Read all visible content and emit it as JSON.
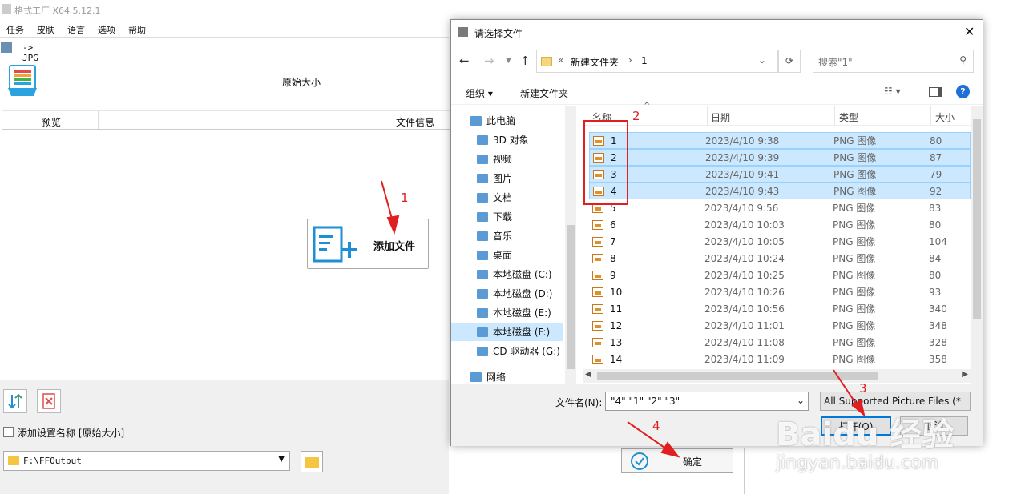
{
  "app": {
    "title": "格式工厂 X64 5.12.1",
    "menu": [
      "任务",
      "皮肤",
      "语言",
      "选项",
      "帮助"
    ],
    "path_label": "-> JPG",
    "size_label": "原始大小",
    "columns": {
      "preview": "预览",
      "fileinfo": "文件信息"
    },
    "add_file_label": "添加文件",
    "add_setting_label": "添加设置名称 [原始大小]",
    "output_folder": "F:\\FFOutput",
    "ok_label": "确定"
  },
  "dialog": {
    "title": "请选择文件",
    "breadcrumb": [
      "«",
      "新建文件夹",
      "›",
      "1"
    ],
    "search_placeholder": "搜索\"1\"",
    "organize_label": "组织 ▾",
    "new_folder_label": "新建文件夹",
    "nav": [
      {
        "label": "此电脑",
        "icon": "computer-icon"
      },
      {
        "label": "3D 对象",
        "icon": "cube-icon"
      },
      {
        "label": "视频",
        "icon": "video-icon"
      },
      {
        "label": "图片",
        "icon": "picture-icon"
      },
      {
        "label": "文档",
        "icon": "document-icon"
      },
      {
        "label": "下载",
        "icon": "download-icon"
      },
      {
        "label": "音乐",
        "icon": "music-icon"
      },
      {
        "label": "桌面",
        "icon": "desktop-icon"
      },
      {
        "label": "本地磁盘 (C:)",
        "icon": "drive-icon"
      },
      {
        "label": "本地磁盘 (D:)",
        "icon": "drive-icon"
      },
      {
        "label": "本地磁盘 (E:)",
        "icon": "drive-icon"
      },
      {
        "label": "本地磁盘 (F:)",
        "icon": "drive-icon"
      },
      {
        "label": "CD 驱动器 (G:)",
        "icon": "cd-icon"
      },
      {
        "label": "网络",
        "icon": "network-icon"
      }
    ],
    "headers": {
      "name": "名称",
      "date": "日期",
      "type": "类型",
      "size": "大小"
    },
    "files": [
      {
        "name": "1",
        "date": "2023/4/10 9:38",
        "type": "PNG 图像",
        "size": "80",
        "selected": true
      },
      {
        "name": "2",
        "date": "2023/4/10 9:39",
        "type": "PNG 图像",
        "size": "87",
        "selected": true
      },
      {
        "name": "3",
        "date": "2023/4/10 9:41",
        "type": "PNG 图像",
        "size": "79",
        "selected": true
      },
      {
        "name": "4",
        "date": "2023/4/10 9:43",
        "type": "PNG 图像",
        "size": "92",
        "selected": true
      },
      {
        "name": "5",
        "date": "2023/4/10 9:56",
        "type": "PNG 图像",
        "size": "83",
        "selected": false
      },
      {
        "name": "6",
        "date": "2023/4/10 10:03",
        "type": "PNG 图像",
        "size": "80",
        "selected": false
      },
      {
        "name": "7",
        "date": "2023/4/10 10:05",
        "type": "PNG 图像",
        "size": "104",
        "selected": false
      },
      {
        "name": "8",
        "date": "2023/4/10 10:24",
        "type": "PNG 图像",
        "size": "84",
        "selected": false
      },
      {
        "name": "9",
        "date": "2023/4/10 10:25",
        "type": "PNG 图像",
        "size": "80",
        "selected": false
      },
      {
        "name": "10",
        "date": "2023/4/10 10:26",
        "type": "PNG 图像",
        "size": "93",
        "selected": false
      },
      {
        "name": "11",
        "date": "2023/4/10 10:56",
        "type": "PNG 图像",
        "size": "340",
        "selected": false
      },
      {
        "name": "12",
        "date": "2023/4/10 11:01",
        "type": "PNG 图像",
        "size": "348",
        "selected": false
      },
      {
        "name": "13",
        "date": "2023/4/10 11:08",
        "type": "PNG 图像",
        "size": "328",
        "selected": false
      },
      {
        "name": "14",
        "date": "2023/4/10 11:09",
        "type": "PNG 图像",
        "size": "358",
        "selected": false
      }
    ],
    "filename_label": "文件名(N):",
    "filename_value": "\"4\" \"1\" \"2\" \"3\"",
    "filetype_value": "All Supported Picture Files (*",
    "open_label": "打开(O)",
    "cancel_label": "取消"
  },
  "annotations": [
    "1",
    "2",
    "3",
    "4"
  ],
  "watermark": {
    "logo": "Baidu 经验",
    "url": "jingyan.baidu.com"
  }
}
